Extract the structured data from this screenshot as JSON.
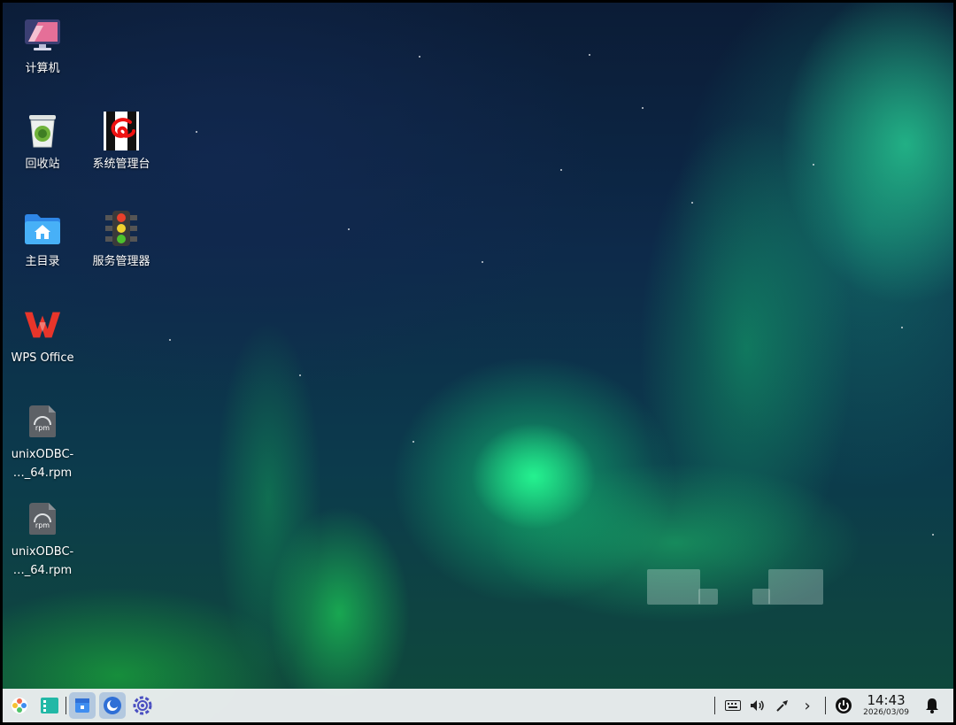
{
  "desktop": {
    "icons": [
      {
        "label": "计算机"
      },
      {
        "label": "回收站"
      },
      {
        "label": "系统管理台"
      },
      {
        "label": "主目录"
      },
      {
        "label": "服务管理器"
      },
      {
        "label": "WPS Office"
      },
      {
        "label": "unixODBC-",
        "label2": "…_64.rpm",
        "badge": "rpm"
      },
      {
        "label": "unixODBC-",
        "label2": "…_64.rpm",
        "badge": "rpm"
      }
    ]
  },
  "taskbar": {
    "clock_time": "14:43",
    "clock_date": "2026/03/09",
    "chevron": "›"
  },
  "colors": {
    "folder": "#3a9bf0",
    "wps_red": "#e8352a",
    "accent": "#2f6fd6"
  }
}
